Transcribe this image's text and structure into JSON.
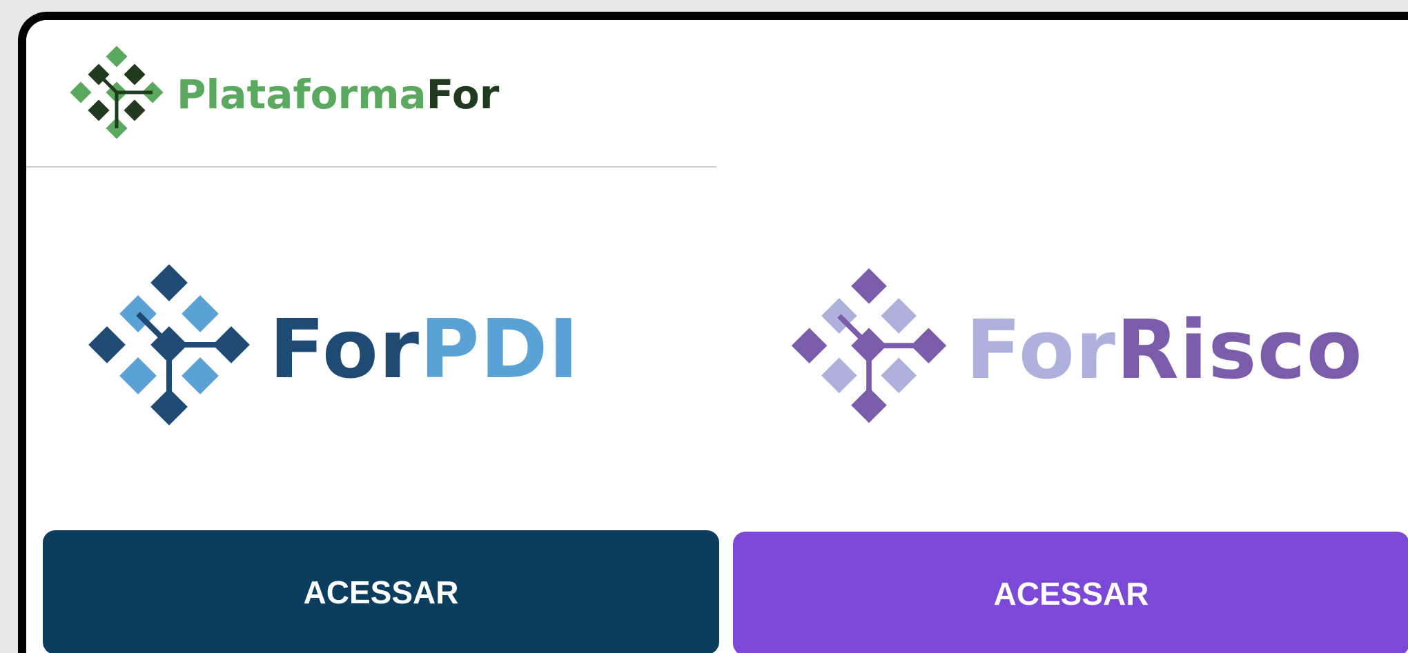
{
  "header": {
    "brand_part1": "Plataforma",
    "brand_part2": "For"
  },
  "products": [
    {
      "id": "forpdi",
      "name_part1": "For",
      "name_part2": "PDI",
      "button_label": "ACESSAR",
      "colors": {
        "dark": "#1e4a73",
        "light": "#5aa2d6",
        "button": "#0b3d5f"
      }
    },
    {
      "id": "forrisco",
      "name_part1": "For",
      "name_part2": "Risco",
      "button_label": "ACESSAR",
      "colors": {
        "dark": "#7a5cab",
        "light": "#aeb1db",
        "button": "#7b48d8"
      }
    }
  ],
  "brand_colors": {
    "light": "#5ba85f",
    "dark": "#1f3a1f"
  },
  "icons": {
    "logo": "diamond-cluster-icon"
  }
}
